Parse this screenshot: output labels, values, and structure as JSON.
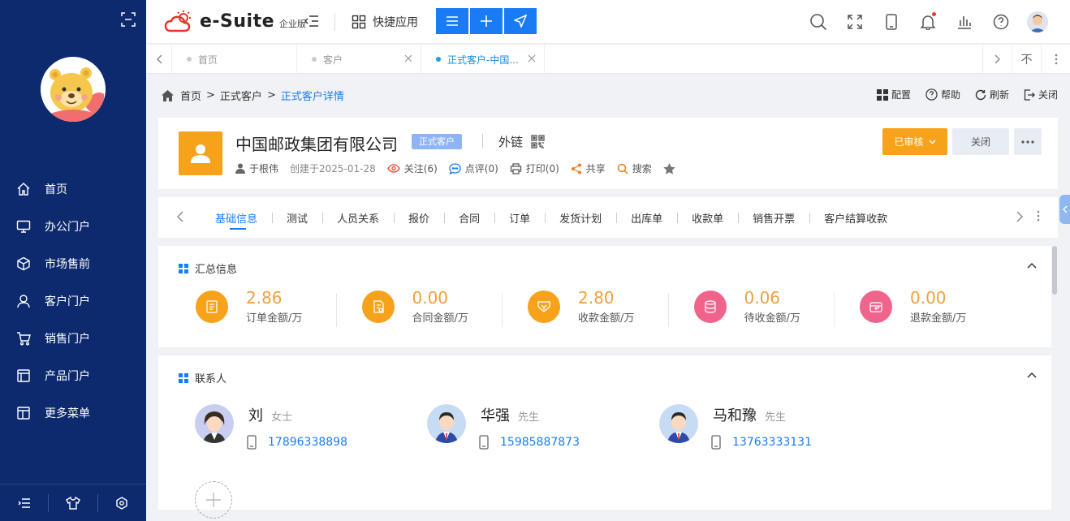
{
  "app": {
    "name": "e-Suite",
    "edition": "企业版",
    "quick_apps": "快捷应用"
  },
  "sidebar": {
    "items": [
      {
        "label": "首页"
      },
      {
        "label": "办公门户"
      },
      {
        "label": "市场售前"
      },
      {
        "label": "客户门户"
      },
      {
        "label": "销售门户"
      },
      {
        "label": "产品门户"
      },
      {
        "label": "更多菜单"
      }
    ]
  },
  "tabs": [
    {
      "label": "首页"
    },
    {
      "label": "客户"
    },
    {
      "label": "正式客户-中国..."
    }
  ],
  "tab_right": {
    "pin": "不"
  },
  "breadcrumb": {
    "home": "首页",
    "sep1": ">",
    "level2": "正式客户",
    "sep2": ">",
    "current": "正式客户详情"
  },
  "page_actions": {
    "config": "配置",
    "help": "帮助",
    "refresh": "刷新",
    "close": "关闭"
  },
  "customer": {
    "name": "中国邮政集团有限公司",
    "badge": "正式客户",
    "external_link": "外链",
    "owner": "于根伟",
    "created": "创建于2025-01-28",
    "follow": "关注(6)",
    "comment": "点评(0)",
    "print": "打印(0)",
    "share": "共享",
    "search": "搜索"
  },
  "header_buttons": {
    "approved": "已审核",
    "close": "关闭"
  },
  "subtabs": [
    "基础信息",
    "测试",
    "人员关系",
    "报价",
    "合同",
    "订单",
    "发货计划",
    "出库单",
    "收款单",
    "销售开票",
    "客户结算收款"
  ],
  "summary": {
    "title": "汇总信息",
    "items": [
      {
        "value": "2.86",
        "label": "订单金额/万",
        "color": "#f7a21b",
        "icon": "order-icon"
      },
      {
        "value": "0.00",
        "label": "合同金额/万",
        "color": "#f7a21b",
        "icon": "contract-icon"
      },
      {
        "value": "2.80",
        "label": "收款金额/万",
        "color": "#f7a21b",
        "icon": "receipt-icon"
      },
      {
        "value": "0.06",
        "label": "待收金额/万",
        "color": "#f0648c",
        "icon": "pending-icon"
      },
      {
        "value": "0.00",
        "label": "退款金额/万",
        "color": "#f0648c",
        "icon": "refund-icon"
      }
    ]
  },
  "contacts": {
    "title": "联系人",
    "items": [
      {
        "name": "刘",
        "title": "女士",
        "phone": "17896338898"
      },
      {
        "name": "华强",
        "title": "先生",
        "phone": "15985887873"
      },
      {
        "name": "马和豫",
        "title": "先生",
        "phone": "13763333131"
      }
    ]
  },
  "colors": {
    "sidebar": "#0d2a6e",
    "accent": "#1a7cf4",
    "orange": "#f7a21b",
    "pink": "#f0648c"
  }
}
